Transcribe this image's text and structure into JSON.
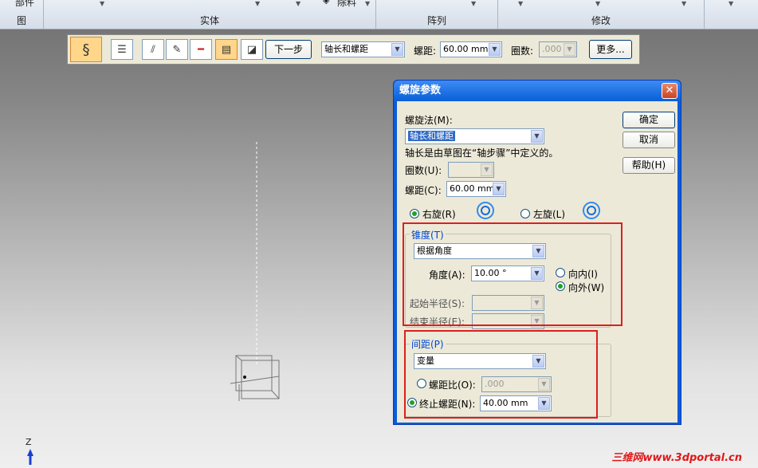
{
  "ribbon": {
    "groups": [
      {
        "caption": "图",
        "top": ""
      },
      {
        "caption": "实体",
        "top": "部件"
      },
      {
        "caption": "阵列",
        "top": ""
      },
      {
        "caption": "修改",
        "top": ""
      },
      {
        "caption": "",
        "top": ""
      }
    ],
    "remove_label": "除料"
  },
  "toolbar": {
    "next_label": "下一步",
    "method_value": "轴长和螺距",
    "pitch_label": "螺距:",
    "pitch_value": "60.00 mm",
    "turns_label": "圈数:",
    "turns_value": ".000",
    "more_label": "更多..."
  },
  "dialog": {
    "title": "螺旋参数",
    "method_label": "螺旋法(M):",
    "method_value": "轴长和螺距",
    "description": "轴长是由草图在“轴步骤”中定义的。",
    "turns_label": "圈数(U):",
    "turns_value": "",
    "pitch_label": "螺距(C):",
    "pitch_value": "60.00 mm",
    "right_hand_label": "右旋(R)",
    "left_hand_label": "左旋(L)",
    "ok_label": "确定",
    "cancel_label": "取消",
    "help_label": "帮助(H)",
    "taper": {
      "group_label": "锥度(T)",
      "type_value": "根据角度",
      "angle_label": "角度(A):",
      "angle_value": "10.00 °",
      "inward_label": "向内(I)",
      "outward_label": "向外(W)",
      "start_radius_label": "起始半径(S):",
      "end_radius_label": "结束半径(E):"
    },
    "spacing": {
      "group_label": "间距(P)",
      "type_value": "变量",
      "ratio_label": "螺距比(O):",
      "ratio_value": ".000",
      "end_pitch_label": "终止螺距(N):",
      "end_pitch_value": "40.00 mm"
    }
  },
  "viewport": {
    "axis_label": "Z"
  },
  "watermark": "三维网www.3dportal.cn",
  "colors": {
    "highlight_box": "#dc1f1f",
    "title_bar": "#0a5fd6",
    "face": "#ece9d8"
  }
}
